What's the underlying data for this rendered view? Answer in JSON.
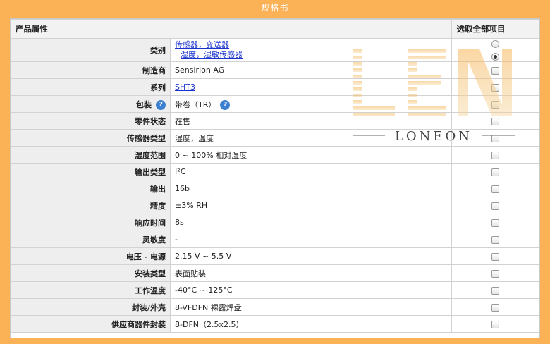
{
  "banner": "规格书",
  "header": {
    "title": "产品属性",
    "select_all": "选取全部项目"
  },
  "rows": [
    {
      "label": "类别",
      "values": [
        "传感器，变送器",
        "湿度，湿敏传感器"
      ],
      "links": true
    },
    {
      "label": "制造商",
      "value": "Sensirion AG"
    },
    {
      "label": "系列",
      "value": "SHT3",
      "link": true
    },
    {
      "label": "包装",
      "value": "带卷（TR）"
    },
    {
      "label": "零件状态",
      "value": "在售"
    },
    {
      "label": "传感器类型",
      "value": "湿度，温度"
    },
    {
      "label": "湿度范围",
      "value": "0 ~ 100% 相对湿度"
    },
    {
      "label": "输出类型",
      "value": "I²C"
    },
    {
      "label": "输出",
      "value": "16b"
    },
    {
      "label": "精度",
      "value": "±3% RH"
    },
    {
      "label": "响应时间",
      "value": "8s"
    },
    {
      "label": "灵敏度",
      "value": "-"
    },
    {
      "label": "电压 - 电源",
      "value": "2.15 V ~ 5.5 V"
    },
    {
      "label": "安装类型",
      "value": "表面贴装"
    },
    {
      "label": "工作温度",
      "value": "-40°C ~ 125°C"
    },
    {
      "label": "封装/外壳",
      "value": "8-VFDFN 裸露焊盘"
    },
    {
      "label": "供应商器件封装",
      "value": "8-DFN（2.5x2.5）"
    }
  ],
  "watermark": {
    "logo_text": "LEN",
    "brand": "LONEON"
  },
  "icons": {
    "help": "help-circle-icon"
  },
  "colors": {
    "background": "#fbb257",
    "link": "#1a33cc",
    "help": "#3a7fd0"
  }
}
